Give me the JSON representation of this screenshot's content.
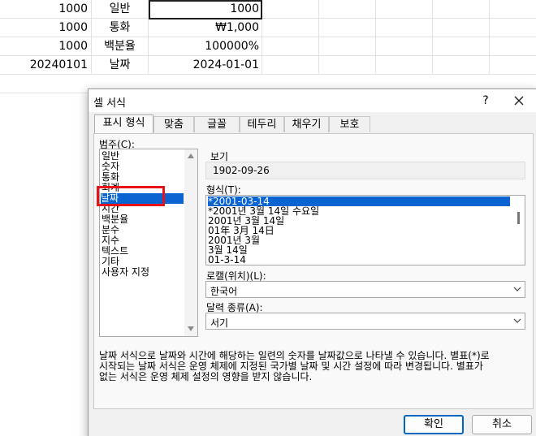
{
  "sheet": {
    "rows": [
      [
        "1000",
        "일반",
        "1000"
      ],
      [
        "1000",
        "통화",
        "₩1,000"
      ],
      [
        "1000",
        "백분율",
        "100000%"
      ],
      [
        "20240101",
        "날짜",
        "2024-01-01"
      ]
    ]
  },
  "dialog": {
    "title": "셀 서식",
    "help_label": "?",
    "tabs": [
      "표시 형식",
      "맞춤",
      "글꼴",
      "테두리",
      "채우기",
      "보호"
    ],
    "category_label": "범주(C):",
    "categories": [
      "일반",
      "숫자",
      "통화",
      "회계",
      "날짜",
      "시간",
      "백분율",
      "분수",
      "지수",
      "텍스트",
      "기타",
      "사용자 지정"
    ],
    "selected_category": "날짜",
    "sample_label": "보기",
    "sample_value": "1902-09-26",
    "type_label": "형식(T):",
    "types": [
      "*2001-03-14",
      "*2001년 3월 14일 수요일",
      "2001년 3월 14일",
      "01年 3月 14日",
      "2001년 3월",
      "3월 14일",
      "01-3-14"
    ],
    "selected_type": "*2001-03-14",
    "locale_label": "로캘(위치)(L):",
    "locale_value": "한국어",
    "calendar_label": "달력 종류(A):",
    "calendar_value": "서기",
    "description": "날짜 서식으로 날짜와 시간에 해당하는 일련의 숫자를 날짜값으로 나타낼 수 있습니다. 별표(*)로\n시작되는 날짜 서식은 운영 체제에 지정된 국가별 날짜 및 시간 설정에 따라 변경됩니다. 별표가\n없는 서식은 운영 체제 설정의 영향을 받지 않습니다.",
    "ok_label": "확인",
    "cancel_label": "취소"
  },
  "colors": {
    "selection": "#0a64d2",
    "highlight": "#e8121a",
    "primary_border": "#0067c0"
  }
}
